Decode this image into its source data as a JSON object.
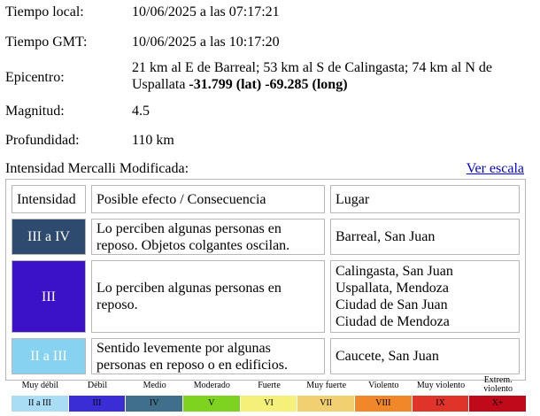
{
  "info": {
    "tiempo_local": {
      "label": "Tiempo local:",
      "value": "10/06/2025 a las 07:17:21"
    },
    "tiempo_gmt": {
      "label": "Tiempo GMT:",
      "value": "10/06/2025 a las 10:17:20"
    },
    "epicentro": {
      "label": "Epicentro:",
      "text": "21 km al E de Barreal; 53 km al S de Calingasta; 74 km al N de Uspallata",
      "lat": "-31.799 (lat)",
      "long": "-69.285 (long)"
    },
    "magnitud": {
      "label": "Magnitud:",
      "value": "4.5"
    },
    "profundidad": {
      "label": "Profundidad:",
      "value": "110 km"
    }
  },
  "mercalli": {
    "heading": "Intensidad Mercalli Modificada:",
    "scale_link": "Ver escala",
    "headers": {
      "intensidad": "Intensidad",
      "efecto": "Posible efecto / Consecuencia",
      "lugar": "Lugar"
    },
    "rows": [
      {
        "intensidad": "III a IV",
        "color": "#2e4a6e",
        "efecto": "Lo perciben algunas personas en reposo. Objetos colgantes oscilan.",
        "lugares": [
          "Barreal, San Juan"
        ]
      },
      {
        "intensidad": "III",
        "color": "#3b12c8",
        "efecto": "Lo perciben algunas personas en reposo.",
        "lugares": [
          "Calingasta, San Juan",
          "Uspallata, Mendoza",
          "Ciudad de San Juan",
          "Ciudad de Mendoza"
        ]
      },
      {
        "intensidad": "II a III",
        "color": "#86d2f0",
        "efecto": "Sentido levemente por algunas personas en reposo o en edificios.",
        "lugares": [
          "Caucete, San Juan"
        ]
      }
    ]
  },
  "legend": {
    "labels": [
      "Muy débil",
      "Débil",
      "Medio",
      "Moderado",
      "Fuerte",
      "Muy fuerte",
      "Violento",
      "Muy violento",
      "Extrem. violento"
    ],
    "cells": [
      {
        "text": "II a III",
        "color": "#a9dcf5"
      },
      {
        "text": "III",
        "color": "#3b2dd6"
      },
      {
        "text": "IV",
        "color": "#3f6f8a"
      },
      {
        "text": "V",
        "color": "#7ed321"
      },
      {
        "text": "VI",
        "color": "#f5f07a"
      },
      {
        "text": "VII",
        "color": "#f0d070"
      },
      {
        "text": "VIII",
        "color": "#f0882a"
      },
      {
        "text": "IX",
        "color": "#e0342a"
      },
      {
        "text": "X+",
        "color": "#c00a1a"
      }
    ]
  }
}
